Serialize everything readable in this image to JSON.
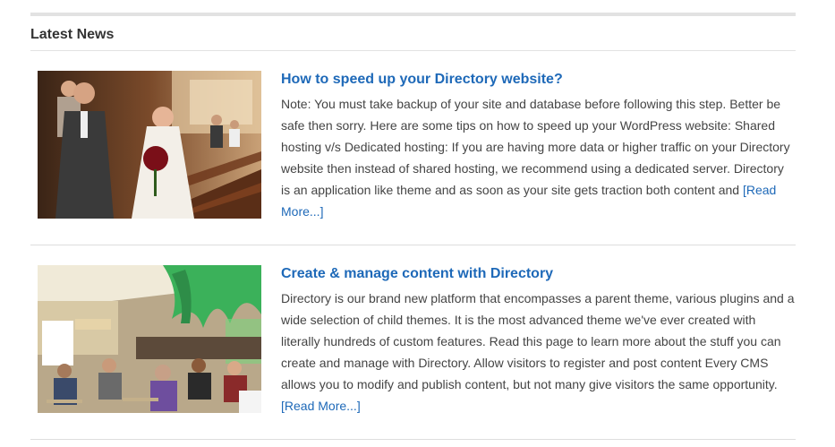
{
  "widget": {
    "title": "Latest News"
  },
  "posts": [
    {
      "title": "How to speed up your Directory website?",
      "excerpt": "Note: You must take backup of your site and database before following this step. Better be safe then sorry. Here are some tips on how to speed up your WordPress website: Shared hosting v/s Dedicated hosting: If you are having more data or higher traffic on your Directory website then instead of shared hosting, we recommend using a dedicated server. Directory is an application like theme and as soon as your site gets traction both content and ",
      "read_more": "[Read More...]"
    },
    {
      "title": "Create & manage content with Directory",
      "excerpt": "Directory is our brand new platform that encompasses a parent theme, various plugins and a wide selection of child themes. It is the most advanced theme we've ever created with literally hundreds of custom features. Read this page to learn more about the stuff you can create and manage with Directory. Allow visitors to register and post content Every CMS allows you to modify and publish content, but not many give visitors the same opportunity. ",
      "read_more": "[Read More...]"
    }
  ],
  "colors": {
    "link": "#1e69b8",
    "text": "#444444",
    "rule": "#e2e2e2"
  }
}
